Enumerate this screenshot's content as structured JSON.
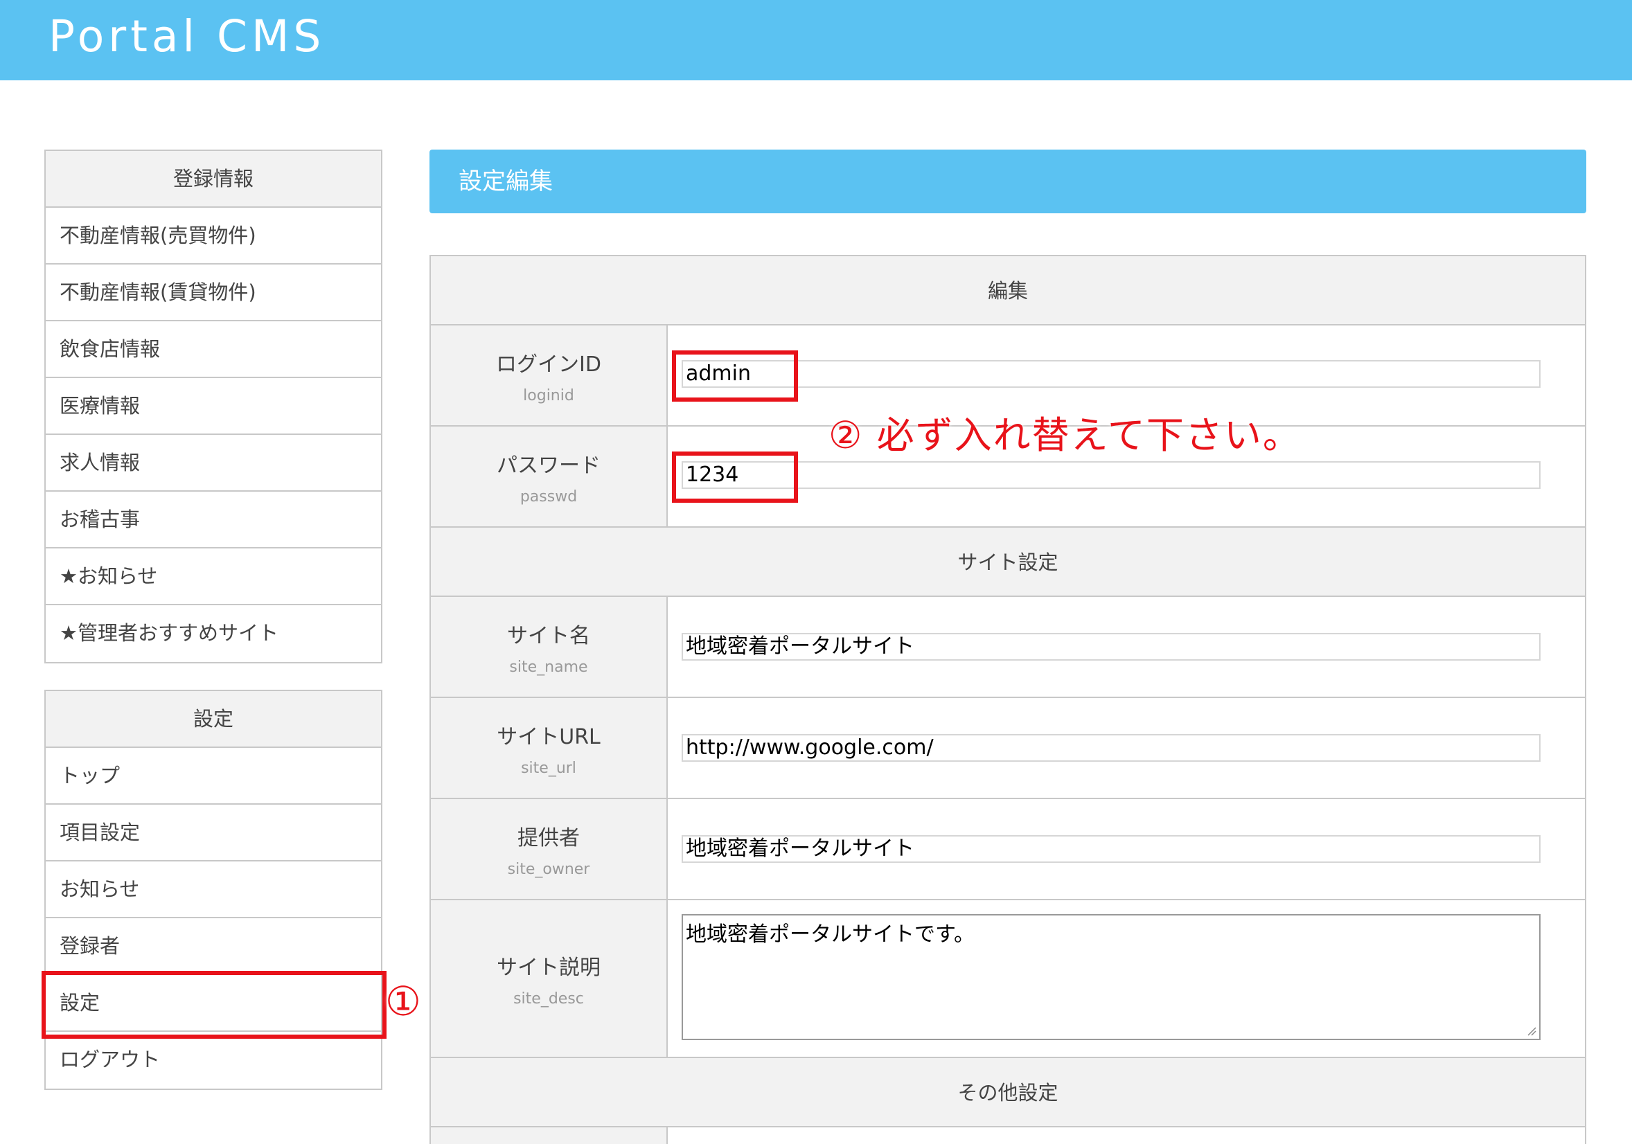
{
  "app": {
    "title": "Portal CMS"
  },
  "sidebar": {
    "group1": {
      "heading": "登録情報",
      "items": [
        {
          "label": "不動産情報(売買物件)"
        },
        {
          "label": "不動産情報(賃貸物件)"
        },
        {
          "label": "飲食店情報"
        },
        {
          "label": "医療情報"
        },
        {
          "label": "求人情報"
        },
        {
          "label": "お稽古事"
        },
        {
          "label": "★お知らせ"
        },
        {
          "label": "★管理者おすすめサイト"
        }
      ]
    },
    "group2": {
      "heading": "設定",
      "items": [
        {
          "label": "トップ"
        },
        {
          "label": "項目設定"
        },
        {
          "label": "お知らせ"
        },
        {
          "label": "登録者"
        },
        {
          "label": "設定"
        },
        {
          "label": "ログアウト"
        }
      ]
    }
  },
  "main": {
    "title": "設定編集",
    "sections": {
      "edit": "編集",
      "site": "サイト設定",
      "other": "その他設定"
    },
    "fields": {
      "loginid": {
        "label": "ログインID",
        "key": "loginid",
        "value": "admin"
      },
      "passwd": {
        "label": "パスワード",
        "key": "passwd",
        "value": "1234"
      },
      "site_name": {
        "label": "サイト名",
        "key": "site_name",
        "value": "地域密着ポータルサイト"
      },
      "site_url": {
        "label": "サイトURL",
        "key": "site_url",
        "value": "http://www.google.com/"
      },
      "site_owner": {
        "label": "提供者",
        "key": "site_owner",
        "value": "地域密着ポータルサイト"
      },
      "site_desc": {
        "label": "サイト説明",
        "key": "site_desc",
        "value": "地域密着ポータルサイトです。"
      }
    }
  },
  "annotations": {
    "marker1": "①",
    "marker2_text": "② 必ず入れ替えて下さい。"
  },
  "colors": {
    "header": "#5bc2f2",
    "highlight": "#e8131a"
  }
}
